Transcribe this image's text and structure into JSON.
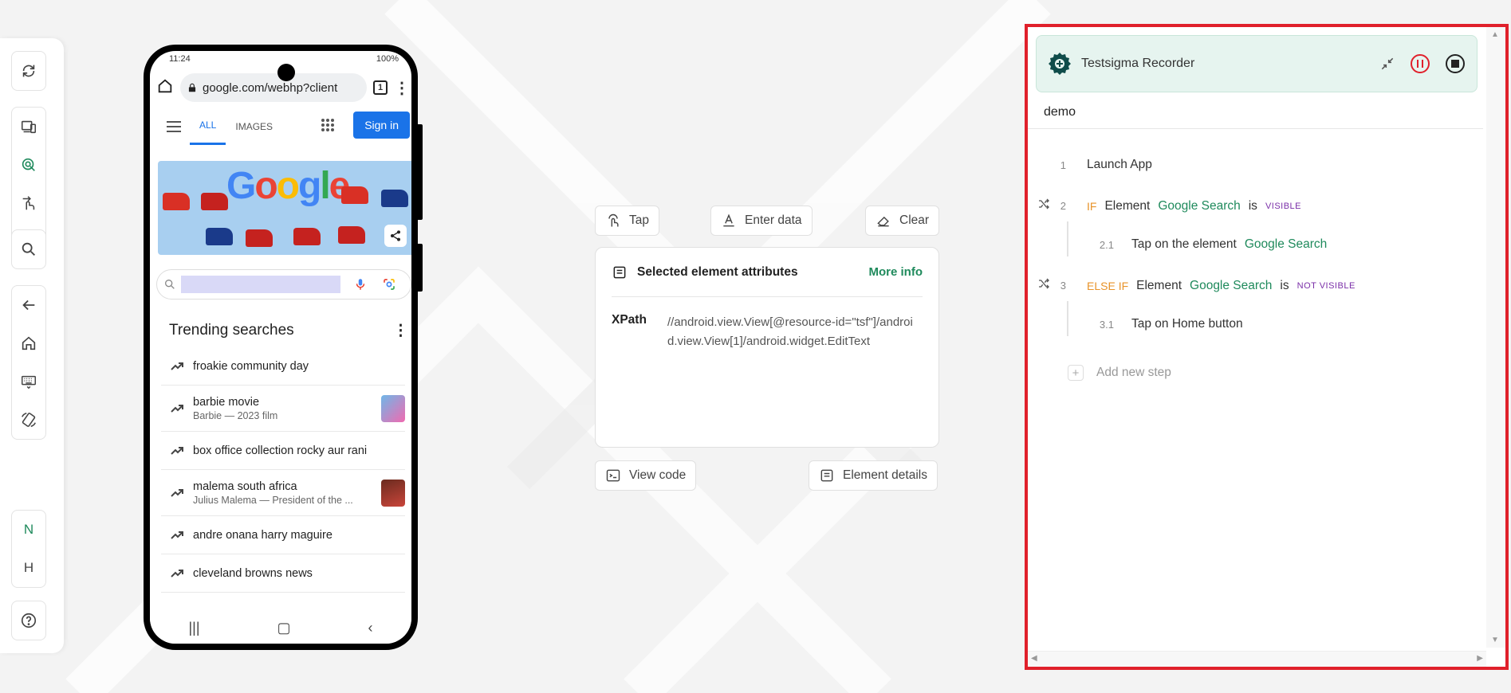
{
  "toolbar": {
    "letters": [
      "N",
      "H"
    ]
  },
  "phone": {
    "status": {
      "time": "11:24",
      "battery": "100%"
    },
    "url": "google.com/webhp?client",
    "tab_count": "1",
    "tabs": [
      "ALL",
      "IMAGES"
    ],
    "signin": "Sign in",
    "doodle_text": "Google",
    "trending_title": "Trending searches",
    "trending": [
      {
        "title": "froakie community day",
        "sub": ""
      },
      {
        "title": "barbie movie",
        "sub": "Barbie — 2023 film"
      },
      {
        "title": "box office collection rocky aur rani",
        "sub": ""
      },
      {
        "title": "malema south africa",
        "sub": "Julius Malema — President of the ..."
      },
      {
        "title": "andre onana harry maguire",
        "sub": ""
      },
      {
        "title": "cleveland browns news",
        "sub": ""
      }
    ]
  },
  "actions": {
    "tap": "Tap",
    "enter_data": "Enter data",
    "clear": "Clear",
    "view_code": "View code",
    "element_details": "Element details"
  },
  "attributes": {
    "title": "Selected element attributes",
    "more_info": "More info",
    "key": "XPath",
    "value": "//android.view.View[@resource-id=\"tsf\"]/android.view.View[1]/android.widget.EditText"
  },
  "recorder": {
    "title": "Testsigma Recorder",
    "test_name": "demo",
    "steps": [
      {
        "num": "1",
        "text": "Launch App"
      },
      {
        "num": "2",
        "kw": "IF",
        "p1": "Element",
        "elem": "Google Search",
        "p2": "is",
        "badge": "VISIBLE"
      },
      {
        "num": "2.1",
        "p1": "Tap on the element",
        "elem": "Google Search"
      },
      {
        "num": "3",
        "kw": "ELSE IF",
        "p1": "Element",
        "elem": "Google Search",
        "p2": "is",
        "badge": "NOT VISIBLE"
      },
      {
        "num": "3.1",
        "p1": "Tap on Home button"
      }
    ],
    "add_step": "Add new step"
  },
  "colors": {
    "accent": "#1f8a5c",
    "highlight_border": "#e0202b",
    "keyword": "#e8932a",
    "badge": "#7a2ea8",
    "google_blue": "#1a73e8"
  }
}
